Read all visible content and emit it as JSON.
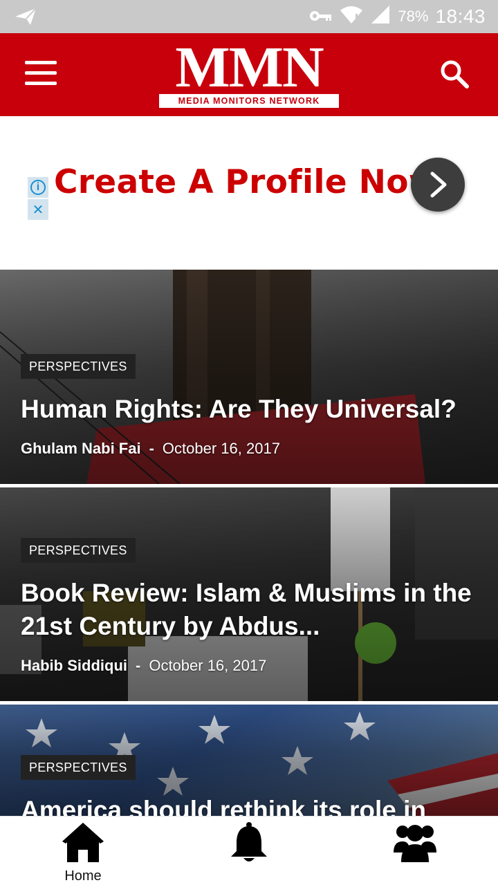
{
  "status_bar": {
    "battery": "78%",
    "time": "18:43",
    "icons": [
      "send-icon",
      "key-icon",
      "wifi-icon",
      "signal-icon"
    ]
  },
  "app_bar": {
    "logo_text": "MMN",
    "logo_subtitle": "MEDIA MONITORS NETWORK",
    "colors": {
      "brand": "#c8000c"
    },
    "icons": [
      "hamburger-menu-icon",
      "search-icon"
    ]
  },
  "ad_banner": {
    "text": "Create A Profile Now",
    "info_symbol": "i",
    "close_symbol": "✕",
    "colors": {
      "text": "#cc0000",
      "button": "#3d3d3d"
    }
  },
  "articles": [
    {
      "category": "PERSPECTIVES",
      "title": "Human Rights: Are They Universal?",
      "author": "Ghulam Nabi Fai",
      "separator": "-",
      "date": "October 16, 2017"
    },
    {
      "category": "PERSPECTIVES",
      "title": "Book Review: Islam & Muslims in the 21st Century by Abdus...",
      "author": "Habib Siddiqui",
      "separator": "-",
      "date": "October 16, 2017"
    },
    {
      "category": "PERSPECTIVES",
      "title": "America should rethink its role in"
    }
  ],
  "bottom_nav": {
    "home_label": "Home",
    "icons": [
      "home-icon",
      "bell-icon",
      "users-icon"
    ]
  }
}
